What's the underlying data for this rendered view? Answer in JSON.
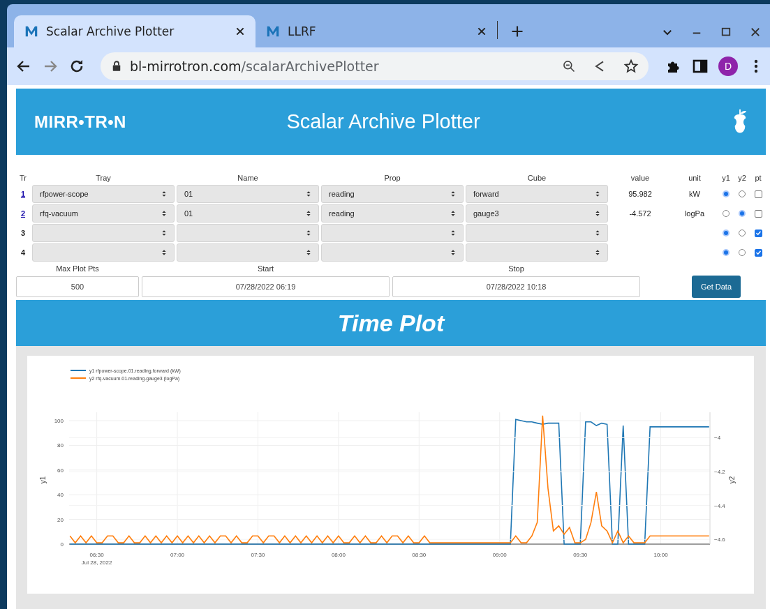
{
  "browser": {
    "tabs": [
      {
        "title": "Scalar Archive Plotter",
        "selected": true
      },
      {
        "title": "LLRF",
        "selected": false
      }
    ],
    "address": {
      "domain": "bl-mirrotron.com",
      "path": "/scalarArchivePlotter"
    },
    "profile": "D"
  },
  "header": {
    "logo": "MIRR•TR•N",
    "title": "Scalar Archive Plotter"
  },
  "traces": {
    "columns": [
      "Tr",
      "Tray",
      "Name",
      "Prop",
      "Cube",
      "value",
      "unit",
      "y1",
      "y2",
      "pt"
    ],
    "rows": [
      {
        "trace": "1",
        "kind": "link",
        "tray": "rfpower-scope",
        "name": "01",
        "prop": "reading",
        "cube": "forward",
        "value": "95.982",
        "unit": "kW",
        "y1_selected": true,
        "y2_selected": false,
        "pt_checked": false
      },
      {
        "trace": "2",
        "kind": "link",
        "tray": "rfq-vacuum",
        "name": "01",
        "prop": "reading",
        "cube": "gauge3",
        "value": "-4.572",
        "unit": "logPa",
        "y1_selected": false,
        "y2_selected": true,
        "pt_checked": false
      },
      {
        "trace": "3",
        "kind": "plain",
        "y1_selected": true,
        "y2_selected": false,
        "pt_checked": true
      },
      {
        "trace": "4",
        "kind": "plain",
        "y1_selected": true,
        "y2_selected": false,
        "pt_checked": true
      }
    ]
  },
  "query": {
    "max_plot_pts": {
      "label": "Max Plot Pts",
      "value": "500"
    },
    "start": {
      "label": "Start",
      "value": "07/28/2022 06:19"
    },
    "stop": {
      "label": "Stop",
      "value": "07/28/2022 10:18"
    },
    "button": "Get Data"
  },
  "plot": {
    "title": "Time Plot",
    "layers": [
      {
        "chart_data": {
          "type": "line",
          "ylabel": "y1",
          "ylim": [
            0,
            106.8
          ],
          "grid": true,
          "legend": "top-left",
          "yticks": [
            0,
            20,
            40,
            60,
            80,
            100
          ],
          "categories": [
            null,
            null,
            null,
            null,
            null,
            "06:30\nJul 28, 2022",
            null,
            null,
            null,
            null,
            null,
            null,
            null,
            null,
            null,
            null,
            null,
            null,
            null,
            null,
            "07:00",
            null,
            null,
            null,
            null,
            null,
            null,
            null,
            null,
            null,
            null,
            null,
            null,
            null,
            null,
            "07:30",
            null,
            null,
            null,
            null,
            null,
            null,
            null,
            null,
            null,
            null,
            null,
            null,
            null,
            null,
            "08:00",
            null,
            null,
            null,
            null,
            null,
            null,
            null,
            null,
            null,
            null,
            null,
            null,
            null,
            null,
            "08:30",
            null,
            null,
            null,
            null,
            null,
            null,
            null,
            null,
            null,
            null,
            null,
            null,
            null,
            null,
            "09:00",
            null,
            null,
            null,
            null,
            null,
            null,
            null,
            null,
            null,
            null,
            null,
            null,
            null,
            null,
            "09:30",
            null,
            null,
            null,
            null,
            null,
            null,
            null,
            null,
            null,
            null,
            null,
            null,
            null,
            null,
            "10:00",
            null,
            null,
            null,
            null,
            null,
            null,
            null,
            null,
            null
          ],
          "series": [
            {
              "name": "y1 rfpower-scope.01.reading.forward (kW)",
              "color": "#1f77b4",
              "values": [
                0,
                0,
                0,
                0,
                0,
                0,
                0,
                0,
                0,
                0,
                0,
                0,
                0,
                0,
                0,
                0,
                0,
                0,
                0,
                0,
                0,
                0,
                0,
                0,
                0,
                0,
                0,
                0,
                0,
                0,
                0,
                0,
                0,
                0,
                0,
                0,
                0,
                0,
                0,
                0,
                0,
                0,
                0,
                0,
                0,
                0,
                0,
                0,
                0,
                0,
                0,
                0,
                0,
                0,
                0,
                0,
                0,
                0,
                0,
                0,
                0,
                0,
                0,
                0,
                0,
                0,
                0,
                0,
                0,
                0,
                0,
                0,
                0,
                0,
                0,
                0,
                0,
                0,
                0,
                0,
                0,
                0,
                0,
                101,
                100,
                99,
                99,
                98,
                97,
                98,
                98,
                98,
                0,
                0,
                0,
                0,
                99,
                99,
                96,
                98,
                97,
                0,
                0,
                96,
                0,
                0,
                0,
                0,
                95,
                95,
                95,
                95,
                95,
                95,
                95,
                95,
                95,
                95,
                95,
                95
              ]
            }
          ]
        }
      },
      {
        "chart_data": {
          "type": "line",
          "ylabel": "y2",
          "ylim": [
            -4.628,
            -3.85
          ],
          "grid": true,
          "legend": "top-left",
          "yticks": [
            {
              "value": -4,
              "label": "−4"
            },
            {
              "value": -4.2,
              "label": "−4.2"
            },
            {
              "value": -4.4,
              "label": "−4.4"
            },
            {
              "value": -4.6,
              "label": "−4.6"
            }
          ],
          "categories": [
            null,
            null,
            null,
            null,
            null,
            null,
            null,
            null,
            null,
            null,
            null,
            null,
            null,
            null,
            null,
            null,
            null,
            null,
            null,
            null,
            null,
            null,
            null,
            null,
            null,
            null,
            null,
            null,
            null,
            null,
            null,
            null,
            null,
            null,
            null,
            null,
            null,
            null,
            null,
            null,
            null,
            null,
            null,
            null,
            null,
            null,
            null,
            null,
            null,
            null,
            null,
            null,
            null,
            null,
            null,
            null,
            null,
            null,
            null,
            null,
            null,
            null,
            null,
            null,
            null,
            null,
            null,
            null,
            null,
            null,
            null,
            null,
            null,
            null,
            null,
            null,
            null,
            null,
            null,
            null,
            null,
            null,
            null,
            null,
            null,
            null,
            null,
            null,
            null,
            null,
            null,
            null,
            null,
            null,
            null,
            null,
            null,
            null,
            null,
            null,
            null,
            null,
            null,
            null,
            null,
            null,
            null,
            null,
            null,
            null,
            null,
            null,
            null,
            null,
            null,
            null,
            null,
            null,
            null,
            null
          ],
          "series": [
            {
              "name": "y2 rfq-vacuum.01.reading.gauge3 (logPa)",
              "color": "#ff7f0e",
              "values": [
                -4.58,
                -4.62,
                -4.58,
                -4.62,
                -4.58,
                -4.62,
                -4.62,
                -4.58,
                -4.58,
                -4.62,
                -4.62,
                -4.58,
                -4.62,
                -4.62,
                -4.58,
                -4.62,
                -4.58,
                -4.62,
                -4.58,
                -4.62,
                -4.58,
                -4.62,
                -4.58,
                -4.62,
                -4.58,
                -4.62,
                -4.58,
                -4.62,
                -4.58,
                -4.58,
                -4.62,
                -4.58,
                -4.62,
                -4.62,
                -4.58,
                -4.58,
                -4.62,
                -4.58,
                -4.58,
                -4.62,
                -4.58,
                -4.62,
                -4.58,
                -4.62,
                -4.58,
                -4.62,
                -4.58,
                -4.62,
                -4.58,
                -4.62,
                -4.58,
                -4.62,
                -4.62,
                -4.58,
                -4.62,
                -4.58,
                -4.62,
                -4.62,
                -4.58,
                -4.62,
                -4.58,
                -4.58,
                -4.62,
                -4.58,
                -4.62,
                -4.62,
                -4.58,
                -4.62,
                -4.62,
                -4.62,
                -4.62,
                -4.62,
                -4.62,
                -4.62,
                -4.62,
                -4.62,
                -4.62,
                -4.62,
                -4.62,
                -4.62,
                -4.62,
                -4.62,
                -4.62,
                -4.58,
                -4.62,
                -4.62,
                -4.58,
                -4.5,
                -3.87,
                -4.3,
                -4.55,
                -4.52,
                -4.57,
                -4.53,
                -4.62,
                -4.62,
                -4.6,
                -4.5,
                -4.32,
                -4.52,
                -4.55,
                -4.62,
                -4.55,
                -4.62,
                -4.58,
                -4.62,
                -4.62,
                -4.62,
                -4.58,
                -4.58,
                -4.58,
                -4.58,
                -4.58,
                -4.58,
                -4.58,
                -4.58,
                -4.58,
                -4.58,
                -4.58,
                -4.58
              ]
            }
          ]
        }
      }
    ]
  }
}
